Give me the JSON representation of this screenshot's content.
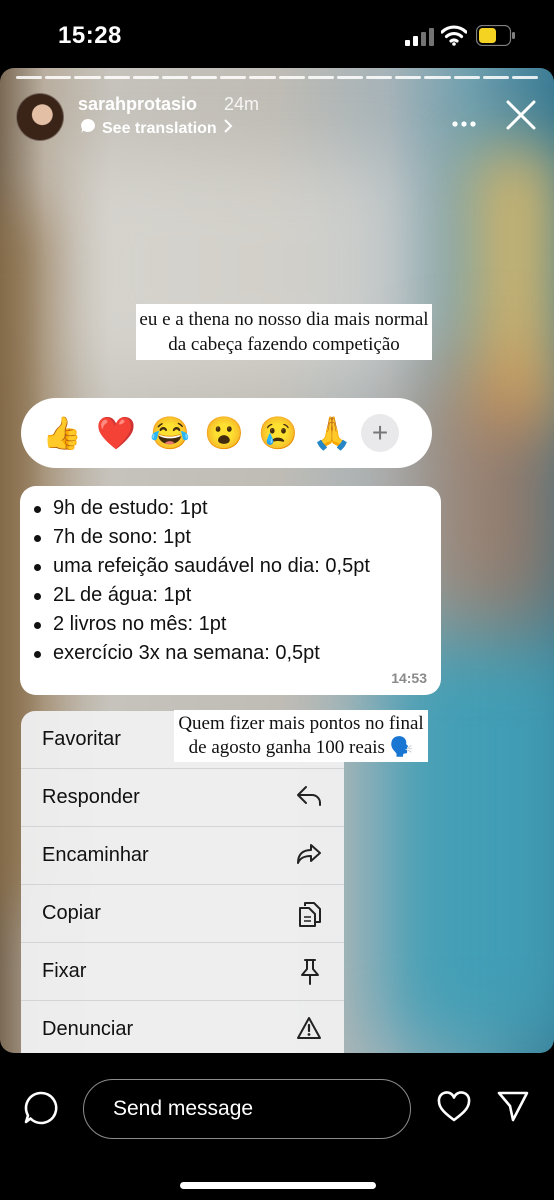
{
  "status_bar": {
    "time": "15:28"
  },
  "story": {
    "username": "sarahprotasio",
    "time_ago": "24m",
    "see_translation": "See translation",
    "caption_top": "eu e a thena no nosso dia mais normal da cabeça fazendo competição",
    "caption_bottom": "Quem fizer mais pontos no final de agosto ganha 100 reais 🗣️",
    "segments": 18
  },
  "reactions": [
    "👍",
    "❤️",
    "😂",
    "😮",
    "😢",
    "🙏"
  ],
  "reactions_more": "+",
  "message": {
    "items": [
      "9h de estudo: 1pt",
      "7h de sono: 1pt",
      "uma refeição saudável no dia: 0,5pt",
      "2L de água: 1pt",
      "2 livros no mês: 1pt",
      "exercício 3x na semana: 0,5pt"
    ],
    "time": "14:53"
  },
  "context_menu": [
    {
      "label": "Favoritar",
      "icon": "star-icon"
    },
    {
      "label": "Responder",
      "icon": "reply-icon"
    },
    {
      "label": "Encaminhar",
      "icon": "forward-icon"
    },
    {
      "label": "Copiar",
      "icon": "copy-icon"
    },
    {
      "label": "Fixar",
      "icon": "pin-icon"
    },
    {
      "label": "Denunciar",
      "icon": "warning-icon"
    }
  ],
  "bottom_bar": {
    "placeholder": "Send message"
  }
}
